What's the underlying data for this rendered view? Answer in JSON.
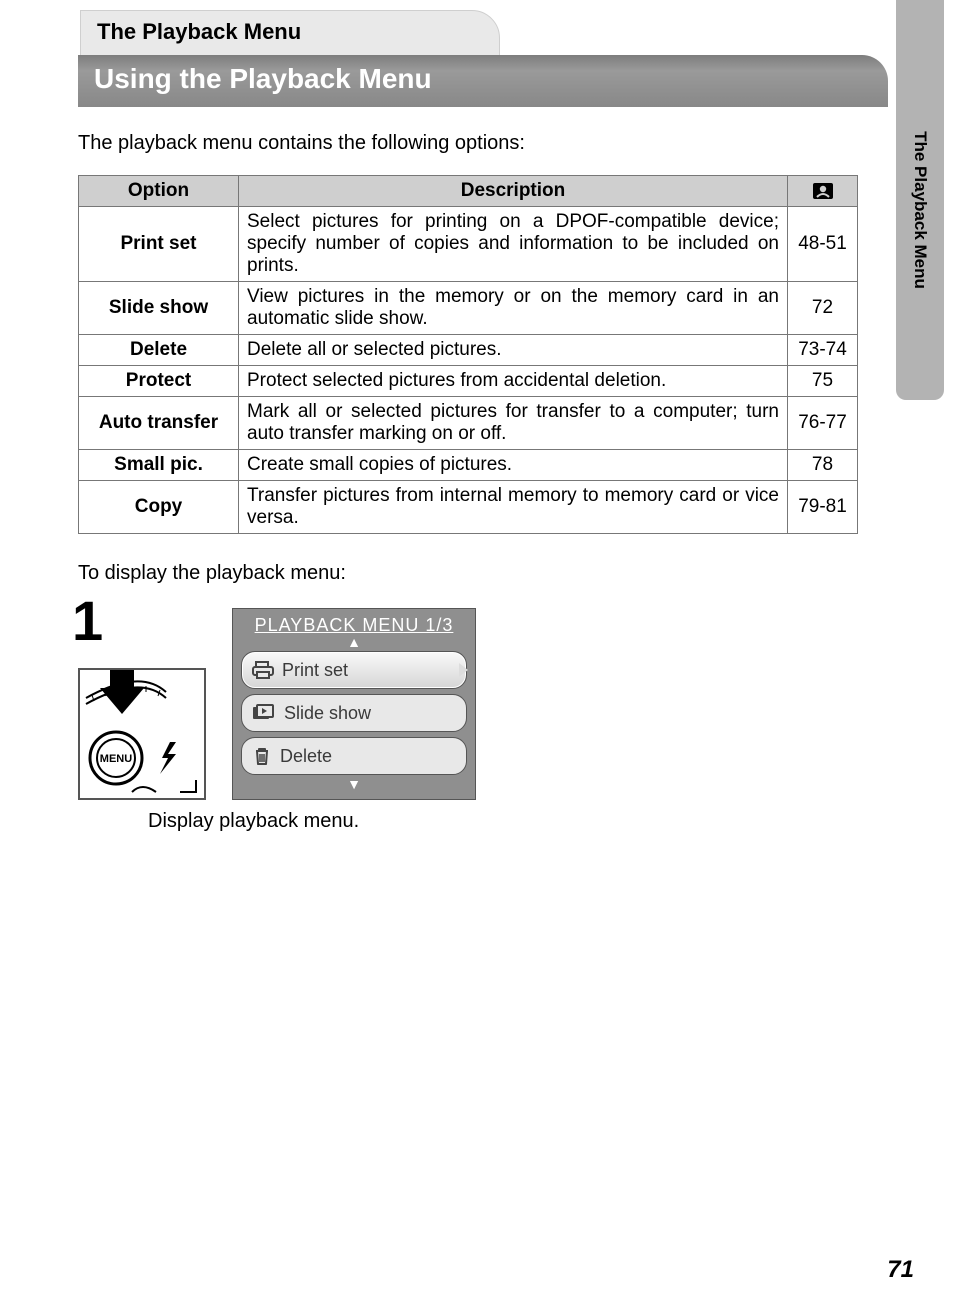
{
  "side_tab": {
    "label": "The Playback Menu"
  },
  "section_tab": "The Playback Menu",
  "main_heading": "Using the Playback Menu",
  "intro_text": "The playback menu contains the following options:",
  "table": {
    "headers": {
      "option": "Option",
      "description": "Description",
      "page_icon": "page-reference-icon"
    },
    "rows": [
      {
        "option": "Print set",
        "description": "Select pictures for printing on a DPOF-compatible device; specify number of copies and information to be included on prints.",
        "page": "48-51"
      },
      {
        "option": "Slide show",
        "description": "View pictures in the memory or on the memory card in an automatic slide show.",
        "page": "72"
      },
      {
        "option": "Delete",
        "description": "Delete all or selected pictures.",
        "page": "73-74"
      },
      {
        "option": "Protect",
        "description": "Protect selected pictures from accidental deletion.",
        "page": "75"
      },
      {
        "option": "Auto transfer",
        "description": "Mark all or selected pictures for transfer to a computer; turn auto transfer marking on or off.",
        "page": "76-77"
      },
      {
        "option": "Small pic.",
        "description": "Create small copies of pictures.",
        "page": "78"
      },
      {
        "option": "Copy",
        "description": "Transfer pictures from internal memory to memory card or vice versa.",
        "page": "79-81"
      }
    ]
  },
  "after_table_text": "To display the playback menu:",
  "step": {
    "number": "1",
    "diagram": {
      "button_label": "MENU"
    },
    "lcd": {
      "title": "PLAYBACK MENU  1/3",
      "items": [
        {
          "icon": "print-icon",
          "label": "Print set",
          "selected": true
        },
        {
          "icon": "slideshow-icon",
          "label": "Slide show",
          "selected": false
        },
        {
          "icon": "trash-icon",
          "label": "Delete",
          "selected": false
        }
      ]
    },
    "caption": "Display playback menu."
  },
  "page_number": "71"
}
